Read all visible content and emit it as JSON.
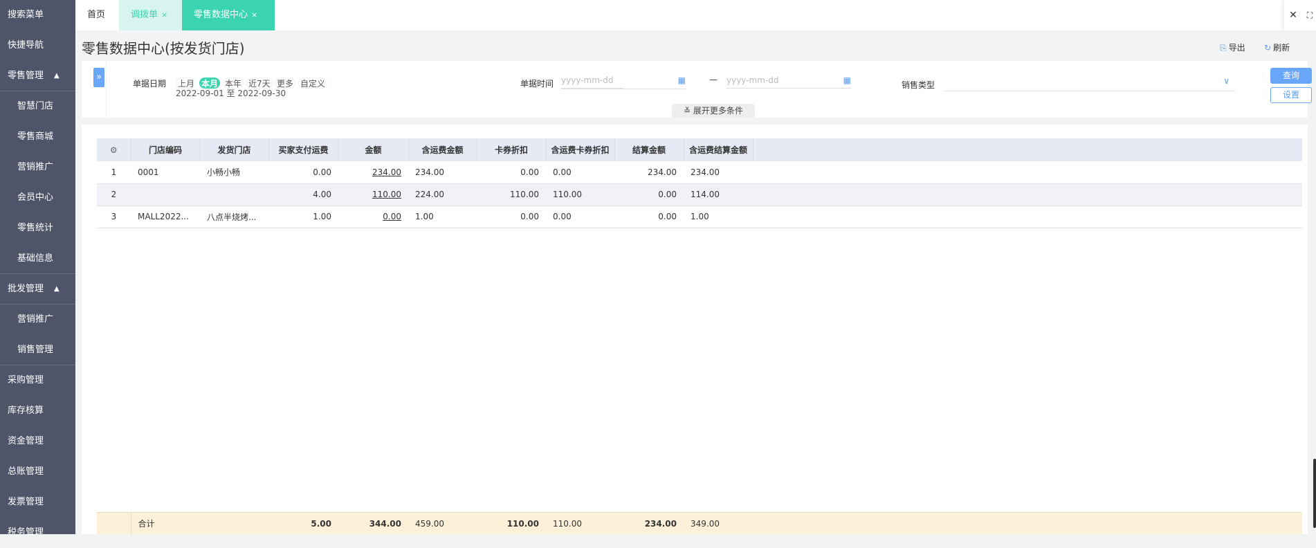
{
  "sidebar": {
    "items": [
      {
        "label": "搜索菜单"
      },
      {
        "label": "快捷导航"
      },
      {
        "label": "零售管理",
        "caret": "▲"
      },
      {
        "label": "智慧门店"
      },
      {
        "label": "零售商城"
      },
      {
        "label": "营销推广"
      },
      {
        "label": "会员中心"
      },
      {
        "label": "零售统计"
      },
      {
        "label": "基础信息"
      },
      {
        "label": "批发管理",
        "caret": "▲"
      },
      {
        "label": "营销推广"
      },
      {
        "label": "销售管理"
      },
      {
        "label": "采购管理"
      },
      {
        "label": "库存核算"
      },
      {
        "label": "资金管理"
      },
      {
        "label": "总账管理"
      },
      {
        "label": "发票管理"
      },
      {
        "label": "税务管理"
      }
    ]
  },
  "tabs": [
    {
      "label": "首页"
    },
    {
      "label": "调拨单",
      "close": "×"
    },
    {
      "label": "零售数据中心",
      "close": "×"
    }
  ],
  "window": {
    "close": "✕",
    "fullscreen": "⛶"
  },
  "page": {
    "title": "零售数据中心(按发货门店)",
    "export": "导出",
    "refresh": "刷新"
  },
  "filter": {
    "date_label": "单据日期",
    "chips": [
      "上月",
      "本月",
      "本年",
      "近7天",
      "更多",
      "自定义"
    ],
    "active_chip": "本月",
    "range": "2022-09-01 至 2022-09-30",
    "time_label": "单据时间",
    "start_placeholder": "yyyy-mm-dd",
    "end_placeholder": "yyyy-mm-dd",
    "dash": "—",
    "sale_type_label": "销售类型",
    "sale_type_value": "",
    "query": "查询",
    "settings": "设置",
    "more": "展开更多条件",
    "expand_icon": "»"
  },
  "table": {
    "columns": [
      "门店编码",
      "发货门店",
      "买家支付运费",
      "金额",
      "含运费金额",
      "卡券折扣",
      "含运费卡券折扣",
      "结算金额",
      "含运费结算金额"
    ],
    "rows": [
      [
        "1",
        "0001",
        "小畅小畅",
        "0.00",
        "234.00",
        "234.00",
        "0.00",
        "0.00",
        "234.00",
        "234.00"
      ],
      [
        "2",
        "",
        "",
        "4.00",
        "110.00",
        "224.00",
        "110.00",
        "110.00",
        "0.00",
        "114.00"
      ],
      [
        "3",
        "MALL2022...",
        "八点半烧烤...",
        "1.00",
        "0.00",
        "1.00",
        "0.00",
        "0.00",
        "0.00",
        "1.00"
      ]
    ],
    "footer": {
      "label": "合计",
      "values": [
        "5.00",
        "344.00",
        "459.00",
        "110.00",
        "110.00",
        "234.00",
        "349.00"
      ]
    }
  },
  "colors": {
    "sidebar": "#4f5468",
    "accent": "#3bd4b0",
    "primary": "#6aa6f8",
    "footer": "#fcf0d9"
  }
}
